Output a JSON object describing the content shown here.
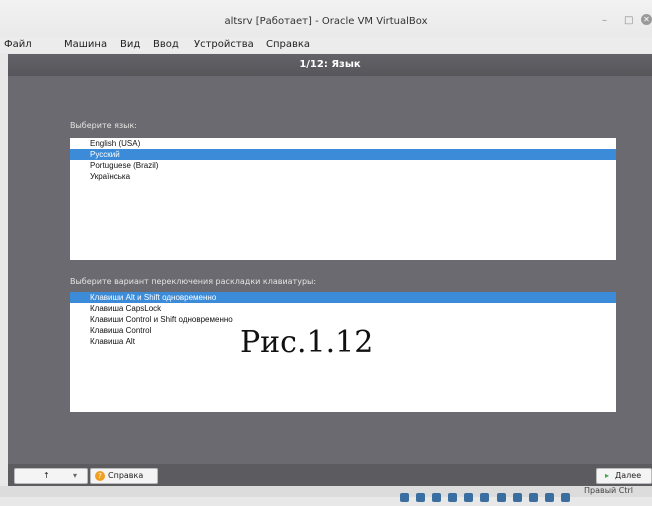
{
  "window": {
    "title": "altsrv [Работает] - Oracle VM VirtualBox",
    "minimize": "–",
    "maximize": "□",
    "close": "✕"
  },
  "menubar": {
    "items": [
      "Файл",
      "Машина",
      "Вид",
      "Ввод",
      "Устройства",
      "Справка"
    ]
  },
  "installer": {
    "step_title": "1/12: Язык",
    "language_label": "Выберите язык:",
    "languages": [
      "English (USA)",
      "Русский",
      "Portuguese (Brazil)",
      "Українська"
    ],
    "selected_language": "Русский",
    "layout_label": "Выберите вариант переключения раскладки клавиатуры:",
    "layouts": [
      "Клавиши Alt и Shift одновременно",
      "Клавиша CapsLock",
      "Клавиши Control и Shift одновременно",
      "Клавиша Control",
      "Клавиша Alt"
    ],
    "selected_layout": "Клавиши Alt и Shift одновременно",
    "back_button": "↑",
    "dropdown_arrow": "▾",
    "help_button": "Справка",
    "next_button": "Далее"
  },
  "caption": "Рис.1.12",
  "statusbar": {
    "host_key": "Правый Ctrl"
  },
  "colors": {
    "selection": "#3b8bd8",
    "panel": "#6a6a70",
    "help_icon": "#f0a020",
    "next_arrow": "#3aa64a"
  }
}
